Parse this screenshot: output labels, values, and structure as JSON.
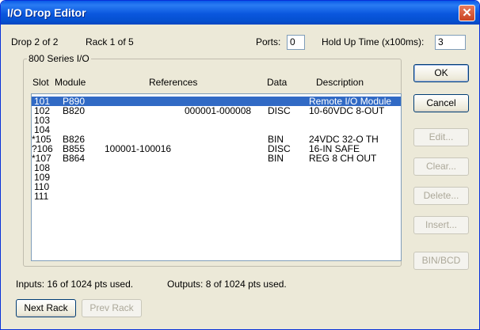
{
  "window": {
    "title": "I/O Drop Editor",
    "close_glyph": "✕"
  },
  "header": {
    "drop": "Drop 2 of 2",
    "rack": "Rack 1 of 5",
    "ports_label": "Ports:",
    "ports_value": "0",
    "holdup_label": "Hold Up Time (x100ms):",
    "holdup_value": "3"
  },
  "group": {
    "title": "800 Series I/O"
  },
  "columns": {
    "slot": "Slot",
    "module": "Module",
    "references": "References",
    "data": "Data",
    "description": "Description"
  },
  "rows": [
    {
      "slot": "101",
      "module": "P890",
      "references": "",
      "data": "",
      "description": "Remote I/O Module",
      "selected": true
    },
    {
      "slot": "102",
      "module": "B820",
      "references": "000001-000008",
      "data": "DISC",
      "description": "10-60VDC 8-OUT"
    },
    {
      "slot": "103",
      "module": "",
      "references": "",
      "data": "",
      "description": ""
    },
    {
      "slot": "104",
      "module": "",
      "references": "",
      "data": "",
      "description": ""
    },
    {
      "slot": "*105",
      "module": "B826",
      "references": "",
      "data": "BIN",
      "description": "24VDC 32-O TH"
    },
    {
      "slot": "?106",
      "module": "B855",
      "references": "100001-100016",
      "data": "DISC",
      "description": "16-IN SAFE"
    },
    {
      "slot": "*107",
      "module": "B864",
      "references": "",
      "data": "BIN",
      "description": "REG 8  CH OUT"
    },
    {
      "slot": "108",
      "module": "",
      "references": "",
      "data": "",
      "description": ""
    },
    {
      "slot": "109",
      "module": "",
      "references": "",
      "data": "",
      "description": ""
    },
    {
      "slot": "110",
      "module": "",
      "references": "",
      "data": "",
      "description": ""
    },
    {
      "slot": "111",
      "module": "",
      "references": "",
      "data": "",
      "description": ""
    }
  ],
  "buttons": {
    "ok": "OK",
    "cancel": "Cancel",
    "edit": "Edit...",
    "clear": "Clear...",
    "delete": "Delete...",
    "insert": "Insert...",
    "binbcd": "BIN/BCD",
    "next_rack": "Next Rack",
    "prev_rack": "Prev Rack"
  },
  "status": {
    "inputs": "Inputs:  16 of 1024 pts used.",
    "outputs": "Outputs:  8 of 1024 pts used."
  },
  "colors": {
    "selection": "#316ac5",
    "title_bar": "#0a57de",
    "dialog_bg": "#ece9d8"
  }
}
